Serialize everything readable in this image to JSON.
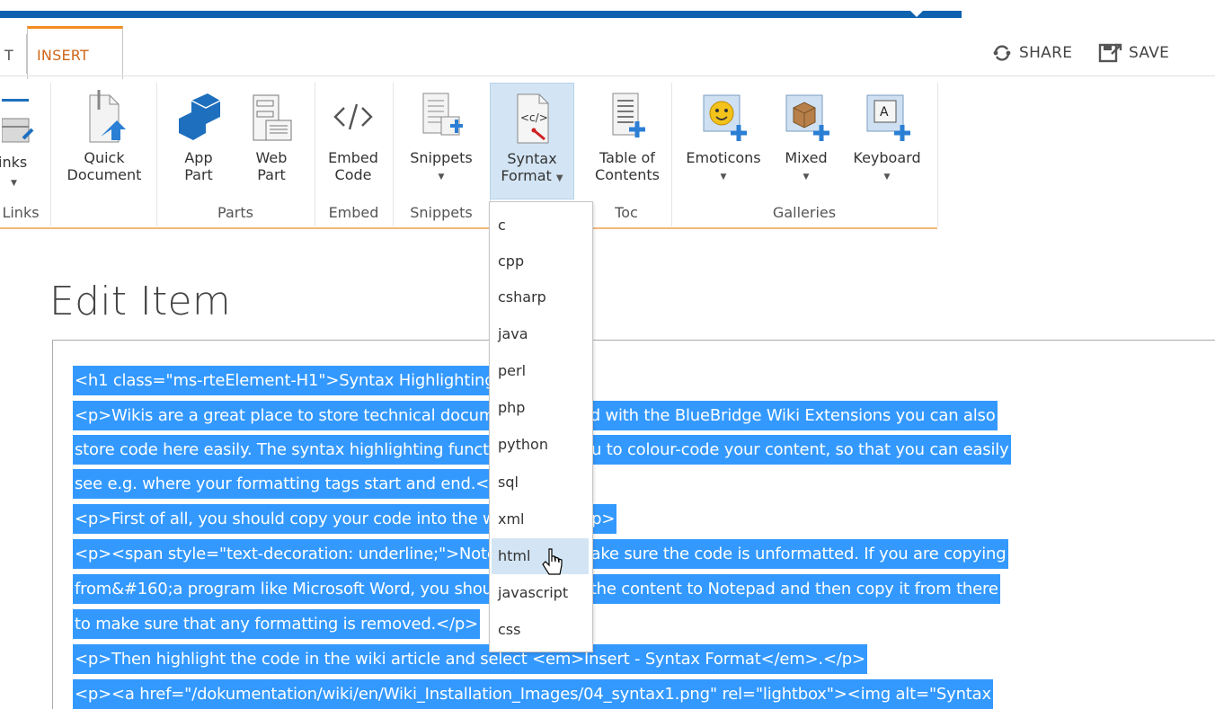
{
  "ribbon_tabs": {
    "previous_partial": "T",
    "insert": "INSERT"
  },
  "actions": {
    "share": "SHARE",
    "save": "SAVE"
  },
  "ribbon": {
    "groups": {
      "links": "Links",
      "parts": "Parts",
      "embed": "Embed",
      "snippets": "Snippets",
      "toc": "Toc",
      "galleries": "Galleries"
    },
    "buttons": {
      "links": "inks",
      "quick_document_1": "Quick",
      "quick_document_2": "Document",
      "app_part_1": "App",
      "app_part_2": "Part",
      "web_part_1": "Web",
      "web_part_2": "Part",
      "embed_code_1": "Embed",
      "embed_code_2": "Code",
      "snippets": "Snippets",
      "syntax_format_1": "Syntax",
      "syntax_format_2": "Format",
      "toc_1": "Table of",
      "toc_2": "Contents",
      "emoticons": "Emoticons",
      "mixed": "Mixed",
      "keyboard": "Keyboard"
    }
  },
  "page": {
    "title": "Edit Item"
  },
  "editor_lines": [
    "<h1 class=\"ms-rteElement-H1\">Syntax Highlighting</h1>",
    "<p>Wikis are a great place to store technical documentation, and with the BlueBridge Wiki Extensions you can also",
    "store code here easily. The syntax highlighting function allows you to colour-code your content, so that you can easily",
    "see e.g. where your formatting tags start and end.</p>",
    "<p>First of all, you should copy your code into the wiki article.</p>",
    "<p><span style=\"text-decoration: underline;\">Note</span>: Make sure the code is unformatted. If you are copying",
    "from&#160;a program like Microsoft Word, you should first copy the content to Notepad and then copy it from there",
    "to make sure that any formatting is removed.</p>",
    "<p>Then highlight the code in the wiki article and select <em>Insert - Syntax Format</em>.</p>",
    "<p><a href=\"/dokumentation/wiki/en/Wiki_Installation_Images/04_syntax1.png\" rel=\"lightbox\"><img alt=\"Syntax"
  ],
  "syntax_menu": {
    "items": [
      "c",
      "cpp",
      "csharp",
      "java",
      "perl",
      "php",
      "python",
      "sql",
      "xml",
      "html",
      "javascript",
      "css"
    ],
    "hovered": "html"
  },
  "colors": {
    "accent_blue": "#0f62ae",
    "selection": "#3399ff",
    "tab_orange": "#f58c1f",
    "hover": "#d3e5f4"
  }
}
